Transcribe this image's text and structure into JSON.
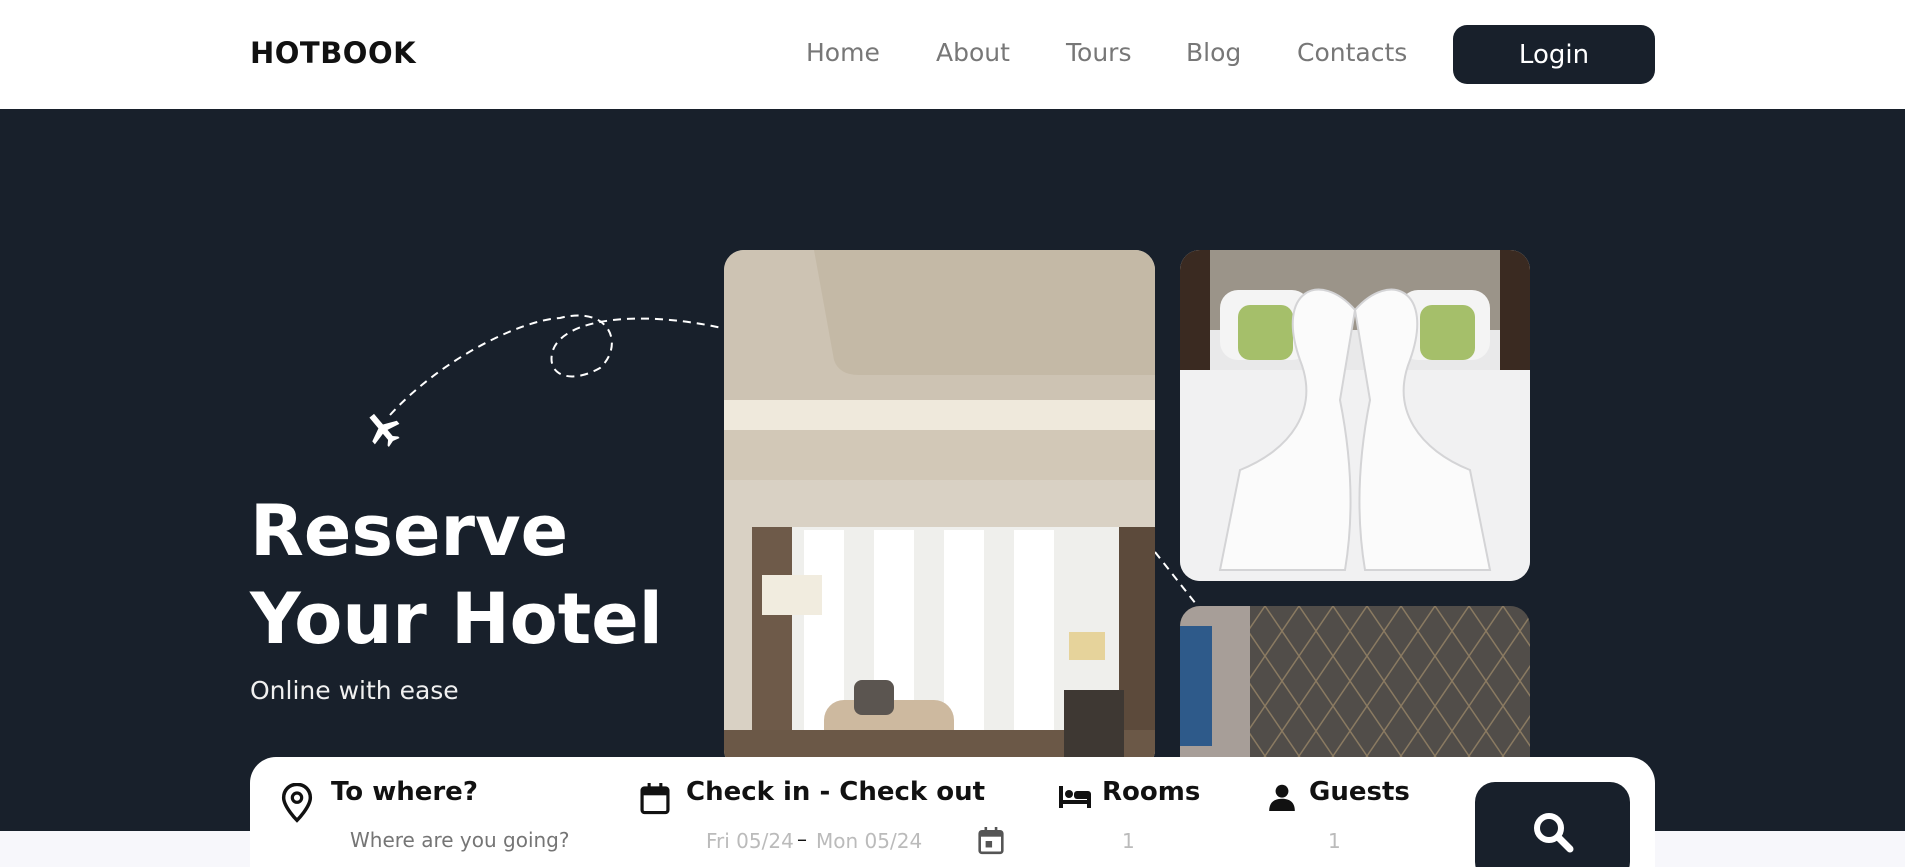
{
  "header": {
    "logo": "HOTBOOK",
    "nav": [
      "Home",
      "About",
      "Tours",
      "Blog",
      "Contacts"
    ],
    "login_label": "Login"
  },
  "hero": {
    "title_line1": "Reserve",
    "title_line2": "Your Hotel",
    "subtitle": "Online with ease"
  },
  "search": {
    "destination_label": "To where?",
    "destination_placeholder": "Where are you going?",
    "dates_label": "Check in - Check out",
    "checkin": "Fri 05/24",
    "date_separator": "–",
    "checkout": "Mon 05/24",
    "rooms_label": "Rooms",
    "rooms_value": "1",
    "guests_label": "Guests",
    "guests_value": "1"
  },
  "icons": {
    "location": "location-pin-icon",
    "calendar": "calendar-icon",
    "bed": "bed-icon",
    "person": "person-icon",
    "search": "search-icon",
    "plane": "airplane-icon"
  },
  "colors": {
    "primary_dark": "#18202b",
    "background": "#ffffff",
    "nav_text": "#777777",
    "accent_text": "#111111"
  }
}
